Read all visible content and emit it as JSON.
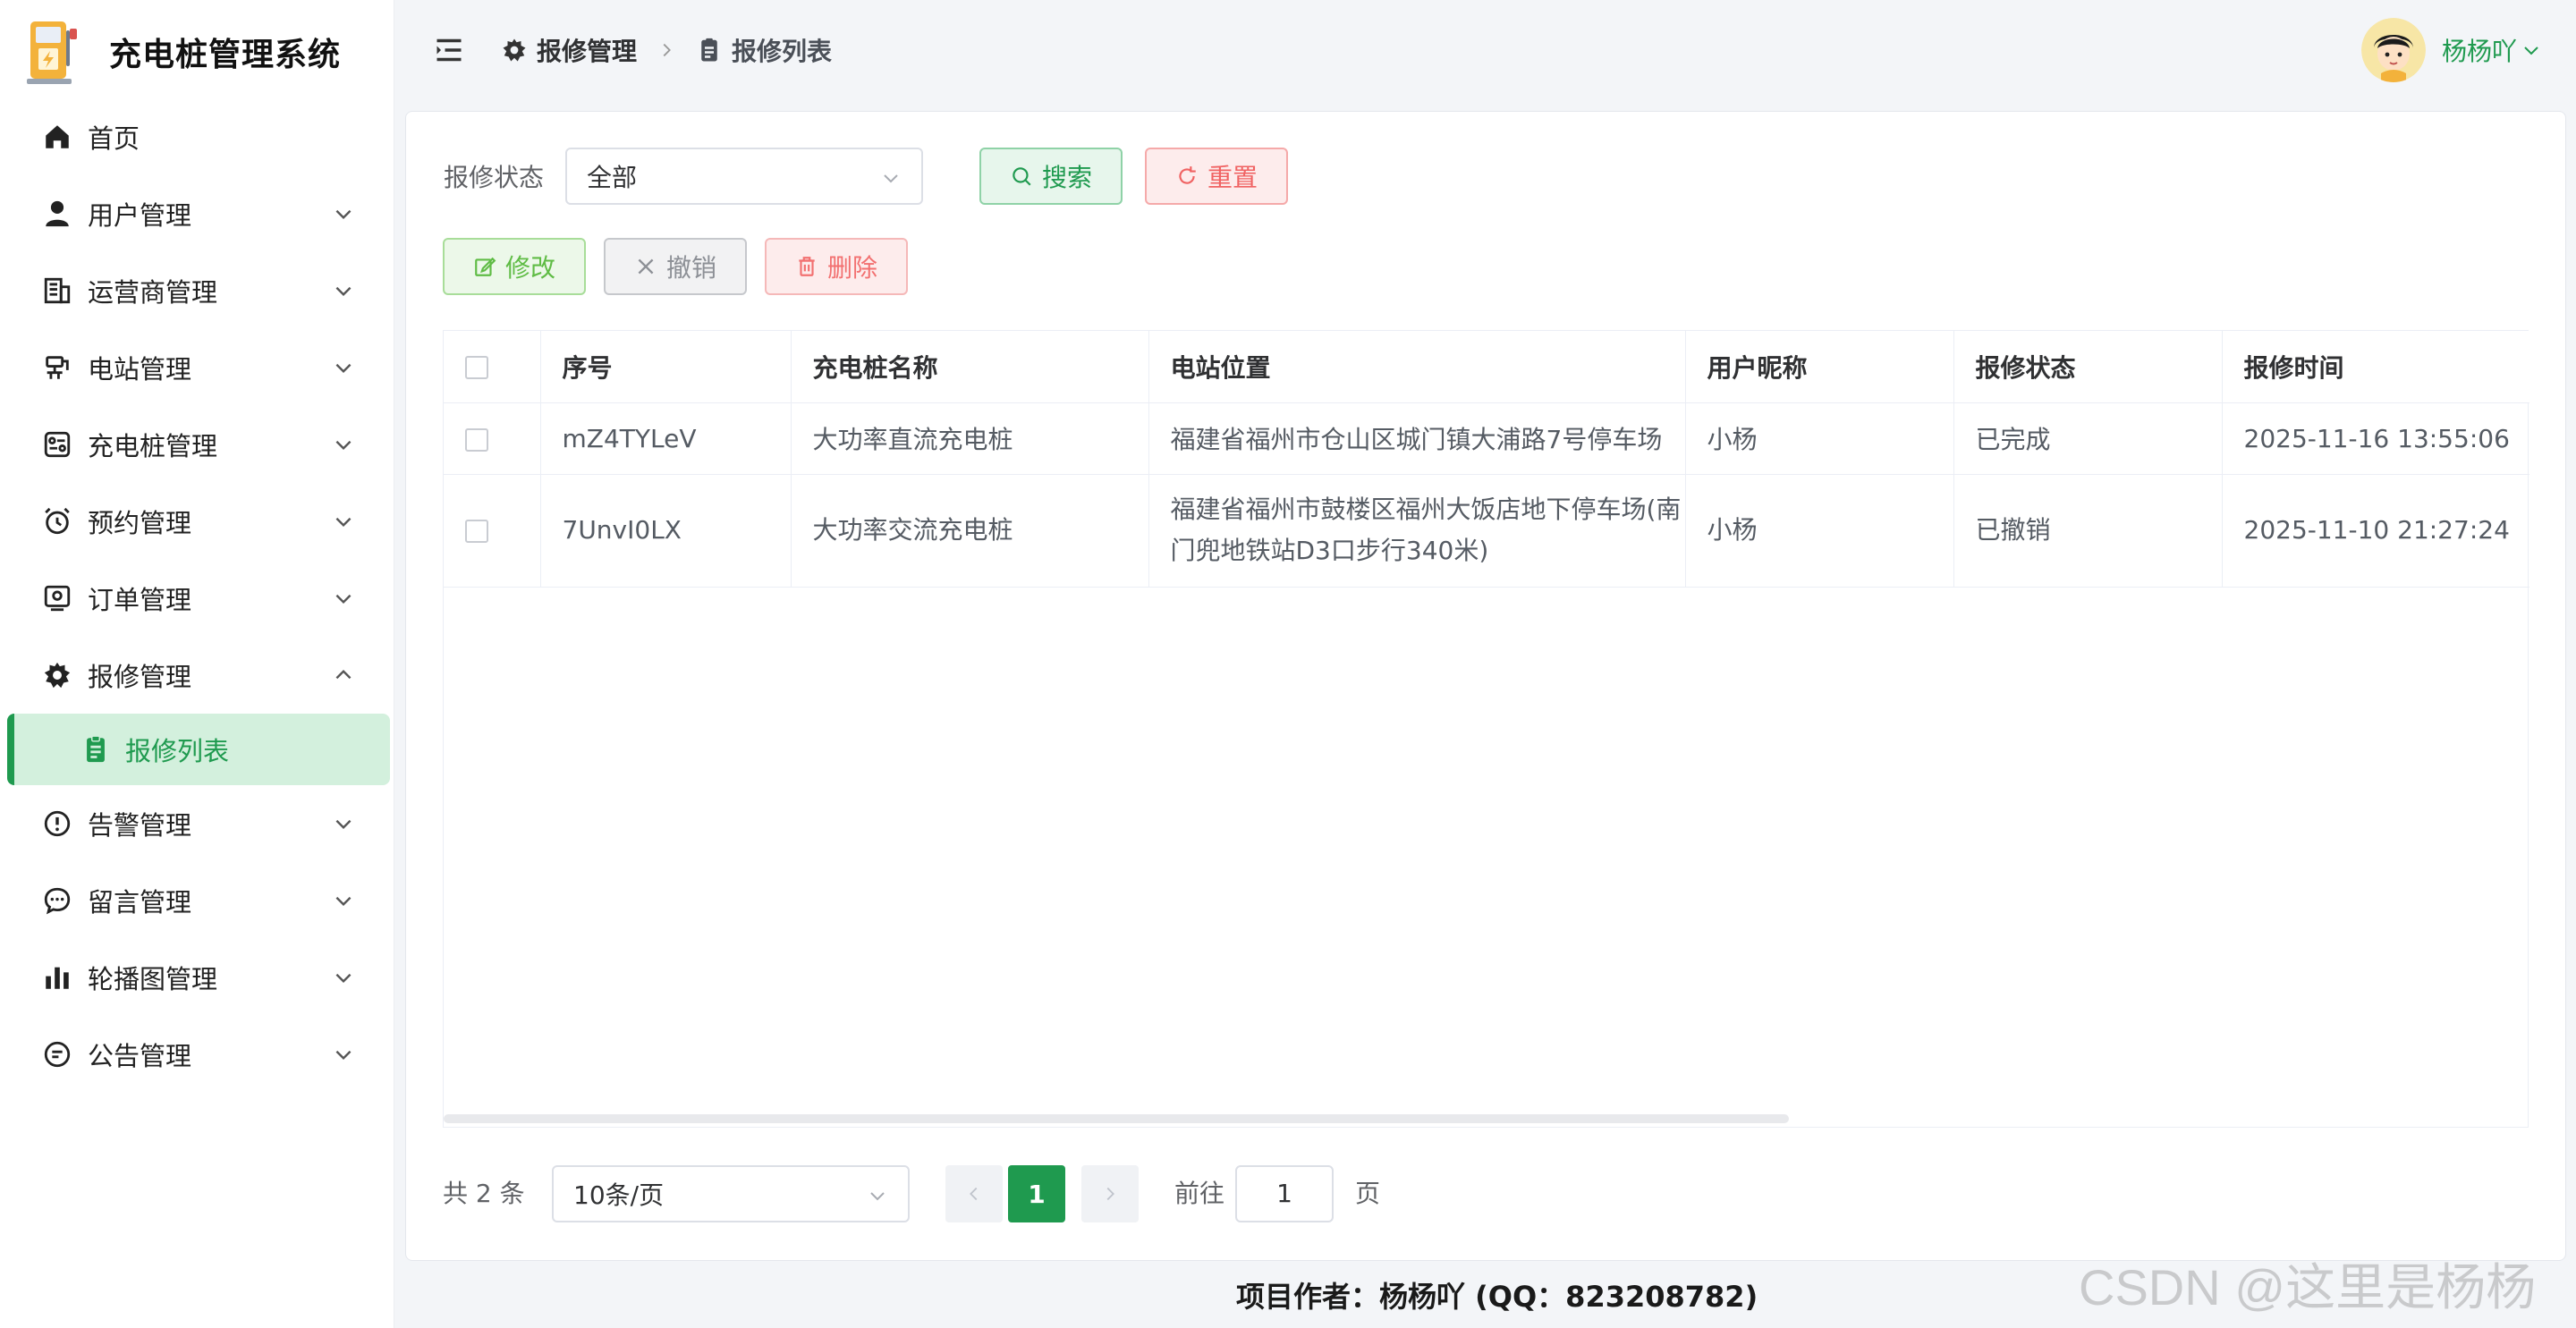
{
  "app": {
    "title": "充电桩管理系统"
  },
  "sidebar": {
    "items": [
      {
        "label": "首页",
        "icon": "home-icon",
        "expandable": false
      },
      {
        "label": "用户管理",
        "icon": "user-icon",
        "expandable": true
      },
      {
        "label": "运营商管理",
        "icon": "building-icon",
        "expandable": true
      },
      {
        "label": "电站管理",
        "icon": "station-icon",
        "expandable": true
      },
      {
        "label": "充电桩管理",
        "icon": "charger-icon",
        "expandable": true
      },
      {
        "label": "预约管理",
        "icon": "alarm-clock-icon",
        "expandable": true
      },
      {
        "label": "订单管理",
        "icon": "order-icon",
        "expandable": true
      },
      {
        "label": "报修管理",
        "icon": "gear-icon",
        "expandable": true,
        "expanded": true
      },
      {
        "label": "告警管理",
        "icon": "warning-icon",
        "expandable": true
      },
      {
        "label": "留言管理",
        "icon": "chat-icon",
        "expandable": true
      },
      {
        "label": "轮播图管理",
        "icon": "bar-chart-icon",
        "expandable": true
      },
      {
        "label": "公告管理",
        "icon": "message-icon",
        "expandable": true
      }
    ],
    "active_sub": {
      "label": "报修列表",
      "icon": "clipboard-icon"
    }
  },
  "header": {
    "breadcrumb": [
      "报修管理",
      "报修列表"
    ],
    "username": "杨杨吖"
  },
  "filter": {
    "label": "报修状态",
    "value": "全部",
    "search_label": "搜索",
    "reset_label": "重置"
  },
  "actions": {
    "edit_label": "修改",
    "cancel_label": "撤销",
    "delete_label": "删除"
  },
  "table": {
    "columns": [
      "序号",
      "充电桩名称",
      "电站位置",
      "用户昵称",
      "报修状态",
      "报修时间"
    ],
    "rows": [
      [
        "mZ4TYLeV",
        "大功率直流充电桩",
        "福建省福州市仓山区城门镇大浦路7号停车场",
        "小杨",
        "已完成",
        "2025-11-16 13:55:06"
      ],
      [
        "7UnvI0LX",
        "大功率交流充电桩",
        "福建省福州市鼓楼区福州大饭店地下停车场(南门兜地铁站D3口步行340米)",
        "小杨",
        "已撤销",
        "2025-11-10 21:27:24"
      ]
    ]
  },
  "pagination": {
    "total_text": "共 2 条",
    "page_size": "10条/页",
    "current_page": "1",
    "goto_label": "前往",
    "goto_value": "1",
    "page_suffix": "页"
  },
  "footer": {
    "text": "项目作者：杨杨吖 (QQ：823208782)"
  },
  "watermark": {
    "text": "CSDN @这里是杨杨吖"
  },
  "colors": {
    "primary": "#1f9a4f",
    "danger": "#f06262",
    "active_bg": "#d3f0dd"
  }
}
